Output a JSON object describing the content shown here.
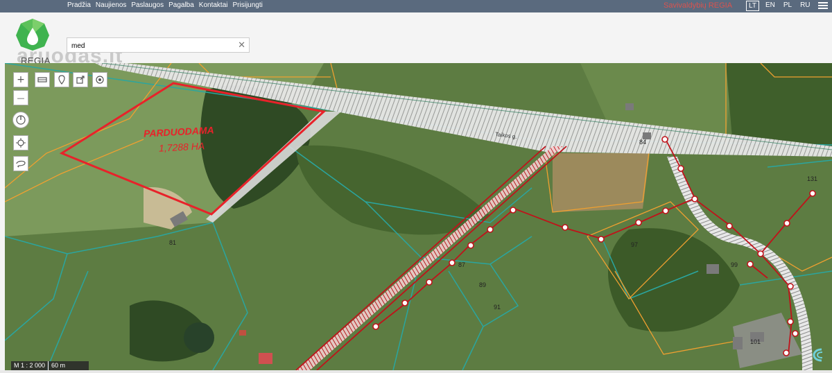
{
  "nav": {
    "items": [
      "Pradžia",
      "Naujienos",
      "Paslaugos",
      "Pagalba",
      "Kontaktai",
      "Prisijungti"
    ]
  },
  "brand": {
    "title": "Savivaldybių REGIA",
    "color": "#d9534f"
  },
  "languages": {
    "items": [
      "LT",
      "EN",
      "PL",
      "RU"
    ],
    "active": "LT"
  },
  "logo": {
    "text": "REGIA",
    "watermark": "aruodas.lt"
  },
  "search": {
    "value": "med",
    "clear_icon": "close-icon"
  },
  "map": {
    "tools": {
      "zoom_in": "+",
      "zoom_out": "—",
      "icons": [
        "layers-icon",
        "pin-icon",
        "export-icon",
        "target-icon",
        "compass-icon",
        "locate-icon",
        "lasso-icon"
      ]
    },
    "sale_label": {
      "line1": "PARDUODAMA",
      "line2": "1,7288 HA"
    },
    "road_label": "Taikos g.",
    "parcel_numbers": [
      "81",
      "87",
      "89",
      "91",
      "97",
      "99",
      "101",
      "131",
      "84"
    ],
    "scale": {
      "ratio": "M 1 : 2 000",
      "distance": "60 m"
    },
    "colors": {
      "sale_boundary": "#e8222a",
      "parcel_teal": "#2aa6a0",
      "parcel_orange": "#f0a030",
      "utility_red": "#c0121a"
    }
  }
}
